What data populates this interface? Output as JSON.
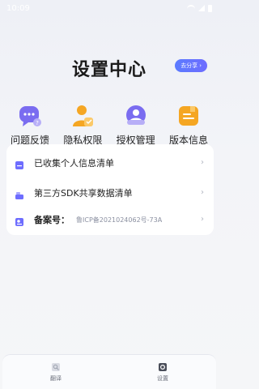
{
  "status": {
    "time": "10:09"
  },
  "header": {
    "title": "设置中心",
    "share_label": "去分享",
    "share_arrow": "›"
  },
  "shortcuts": [
    {
      "label": "问题反馈",
      "icon": "feedback-chat-icon"
    },
    {
      "label": "隐私权限",
      "icon": "privacy-user-icon"
    },
    {
      "label": "授权管理",
      "icon": "authorization-icon"
    },
    {
      "label": "版本信息",
      "icon": "version-info-icon"
    }
  ],
  "list": [
    {
      "label": "已收集个人信息清单",
      "icon": "document-list-icon"
    },
    {
      "label": "第三方SDK共享数据清单",
      "icon": "share-data-icon"
    },
    {
      "label": "备案号：",
      "value": "鲁ICP备2021024062号-73A",
      "icon": "record-id-icon"
    }
  ],
  "chevron": "›",
  "tabbar": [
    {
      "label": "翻译",
      "icon": "translate-icon"
    },
    {
      "label": "设置",
      "icon": "settings-icon"
    }
  ],
  "colors": {
    "accent": "#5b6cff",
    "shortcut_purple": "#7a6cf0",
    "shortcut_orange": "#f5a623"
  }
}
